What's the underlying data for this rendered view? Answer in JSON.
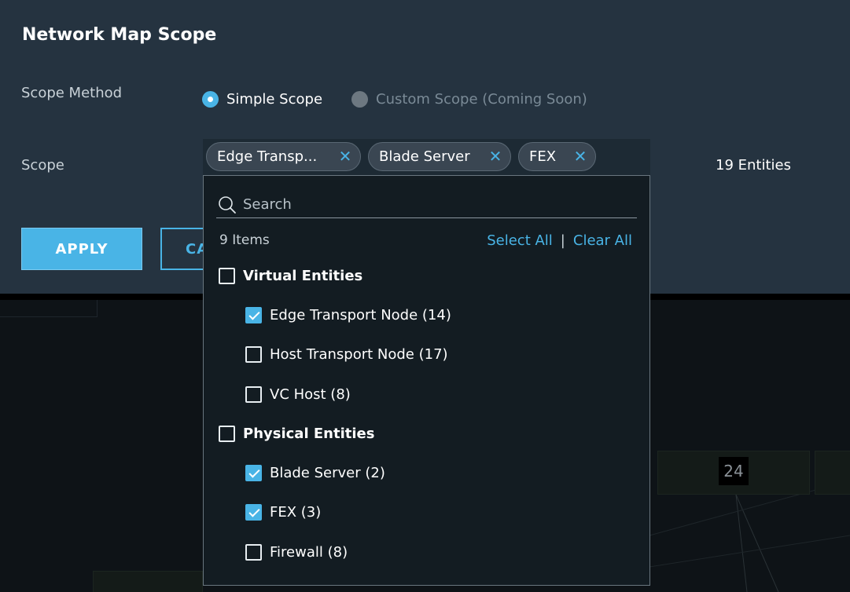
{
  "panel": {
    "title": "Network Map Scope",
    "scope_method_label": "Scope Method",
    "scope_label": "Scope",
    "entities_count": "19 Entities",
    "apply_label": "APPLY",
    "cancel_label": "CA"
  },
  "scope_method": {
    "options": [
      {
        "label": "Simple Scope",
        "selected": true
      },
      {
        "label": "Custom Scope (Coming Soon)",
        "selected": false,
        "disabled": true
      }
    ]
  },
  "chips": [
    {
      "label": "Edge Transp..."
    },
    {
      "label": "Blade Server"
    },
    {
      "label": "FEX"
    }
  ],
  "dropdown": {
    "search_placeholder": "Search",
    "items_count": "9 Items",
    "select_all": "Select All",
    "separator": "|",
    "clear_all": "Clear All",
    "groups": [
      {
        "label": "Virtual Entities",
        "checked": false,
        "items": [
          {
            "label": "Edge Transport Node (14)",
            "checked": true
          },
          {
            "label": "Host Transport Node (17)",
            "checked": false
          },
          {
            "label": "VC Host (8)",
            "checked": false
          }
        ]
      },
      {
        "label": "Physical Entities",
        "checked": false,
        "items": [
          {
            "label": "Blade Server (2)",
            "checked": true
          },
          {
            "label": "FEX (3)",
            "checked": true
          },
          {
            "label": "Firewall (8)",
            "checked": false
          }
        ]
      }
    ]
  },
  "map": {
    "badge_value": "24"
  },
  "icons": {
    "chip_remove": "close-icon",
    "search": "search-icon"
  },
  "colors": {
    "accent": "#49b4e6",
    "panel_bg": "#253340",
    "dropdown_bg": "#131c22"
  }
}
